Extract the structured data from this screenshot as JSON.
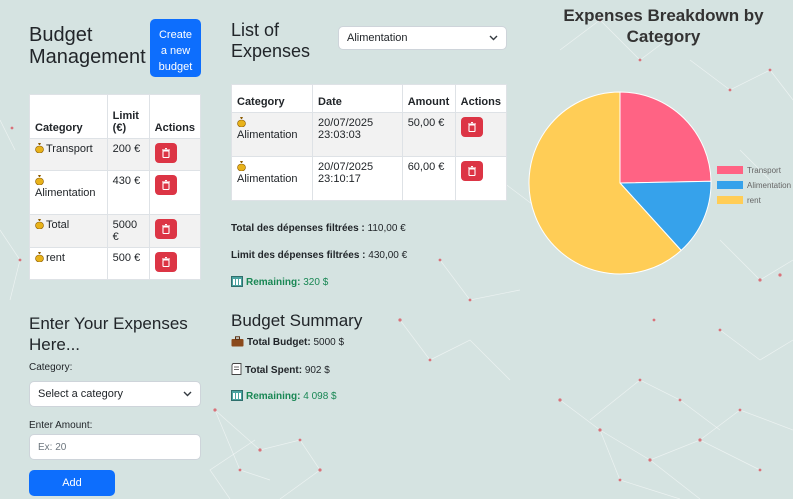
{
  "budget": {
    "title_line1": "Budget",
    "title_line2": "Management",
    "create_button": [
      "Create",
      "a new",
      "budget"
    ],
    "headers": {
      "category": "Category",
      "limit_line1": "Limit",
      "limit_line2": "(€)",
      "actions": "Actions"
    },
    "rows": [
      {
        "category": "Transport",
        "limit": "200 €"
      },
      {
        "category": "Alimentation",
        "limit": "430 €"
      },
      {
        "category": "Total",
        "limit": "5000 €"
      },
      {
        "category": "rent",
        "limit": "500 €"
      }
    ]
  },
  "form": {
    "title_line1": "Enter Your Expenses",
    "title_line2": "Here...",
    "category_label": "Category:",
    "category_value": "Select a category",
    "amount_label": "Enter Amount:",
    "amount_placeholder": "Ex: 20",
    "add_button": "Add"
  },
  "expenses": {
    "title_line1": "List of",
    "title_line2": "Expenses",
    "filter_value": "Alimentation",
    "headers": {
      "category": "Category",
      "date": "Date",
      "amount": "Amount",
      "actions": "Actions"
    },
    "rows": [
      {
        "category": "Alimentation",
        "date_line1": "20/07/2025",
        "date_line2": "23:03:03",
        "amount": "50,00 €"
      },
      {
        "category": "Alimentation",
        "date_line1": "20/07/2025",
        "date_line2": "23:10:17",
        "amount": "60,00 €"
      }
    ],
    "total_filtered_label": "Total des dépenses filtrées :",
    "total_filtered_value": "110,00 €",
    "limit_filtered_label": "Limit des dépenses filtrées :",
    "limit_filtered_value": "430,00 €",
    "remaining_label": "Remaining:",
    "remaining_value": "320 $"
  },
  "summary": {
    "title": "Budget Summary",
    "total_budget_label": "Total Budget:",
    "total_budget_value": "5000 $",
    "total_spent_label": "Total Spent:",
    "total_spent_value": "902 $",
    "remaining_label": "Remaining:",
    "remaining_value": "4 098 $"
  },
  "chart_data": {
    "type": "pie",
    "title": "Expenses Breakdown by Category",
    "labels": [
      "Transport",
      "Alimentation",
      "rent"
    ],
    "values": [
      200,
      110,
      500
    ],
    "colors": [
      "#ff6384",
      "#36a2eb",
      "#ffcd56"
    ],
    "legend": "right"
  },
  "colors": {
    "primary": "#0d6efd",
    "danger": "#dc3545",
    "success": "#198754",
    "background": "#d5e3e1"
  }
}
